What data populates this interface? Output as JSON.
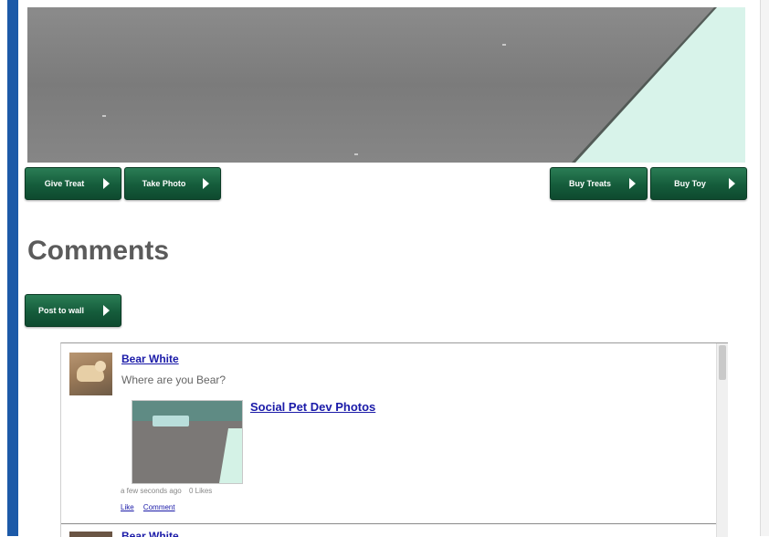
{
  "controls": {
    "give_treat": "Give Treat",
    "take_photo": "Take Photo",
    "buy_treats": "Buy Treats",
    "buy_toy": "Buy Toy"
  },
  "comments": {
    "heading": "Comments",
    "post_to_wall": "Post to wall"
  },
  "wall": {
    "posts": [
      {
        "author": "Bear White",
        "text": "Where are you Bear?",
        "attachment_title": "Social Pet Dev Photos",
        "timestamp": "a few seconds ago",
        "likes": "0 Likes",
        "like_label": "Like",
        "comment_label": "Comment"
      },
      {
        "author": "Bear White"
      }
    ]
  },
  "colors": {
    "button_green": "#155c3b",
    "sidebar_blue": "#1c5aa8",
    "link_blue": "#1a1aa8",
    "heading_gray": "#5b5b5b"
  }
}
